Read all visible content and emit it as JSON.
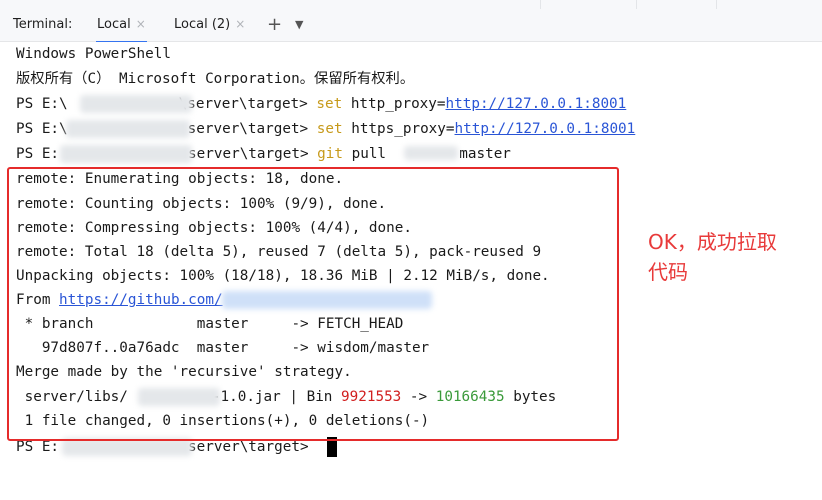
{
  "toolbar": {
    "label": "Terminal:",
    "tabs": [
      {
        "label": "Local",
        "close": "×"
      },
      {
        "label": "Local (2)",
        "close": "×"
      }
    ],
    "add": "+",
    "more": "⌄"
  },
  "terminal": {
    "l1": "Windows PowerShell",
    "l2": "版权所有（C） Microsoft Corporation。保留所有权利。",
    "l3": {
      "pre": "PS E:\\",
      "path": "\\server\\target> ",
      "cmd": "set",
      "rest": " http_proxy=",
      "url": "http://127.0.0.1:8001"
    },
    "l4": {
      "pre": "PS E:\\",
      "path": "server\\target> ",
      "cmd": "set",
      "rest": " https_proxy=",
      "url": "http://127.0.0.1:8001"
    },
    "l5": {
      "pre": "PS E:",
      "path": "server\\target> ",
      "cmd": "git",
      "rest": " pull ",
      "rest2": " master"
    },
    "l6": "remote: Enumerating objects: 18, done.",
    "l7": "remote: Counting objects: 100% (9/9), done.",
    "l8": "remote: Compressing objects: 100% (4/4), done.",
    "l9": "remote: Total 18 (delta 5), reused 7 (delta 5), pack-reused 9",
    "l10": "Unpacking objects: 100% (18/18), 18.36 MiB | 2.12 MiB/s, done.",
    "l11": {
      "pre": "From ",
      "url": "https://github.com/"
    },
    "l12": " * branch            master     -> FETCH_HEAD",
    "l13": "   97d807f..0a76adc  master     -> wisdom/master",
    "l14": "Merge made by the 'recursive' strategy.",
    "l15": {
      "pre": " server/libs/",
      "mid": "-1.0.jar | Bin ",
      "old": "9921553",
      "arrow": " -> ",
      "new": "10166435",
      "tail": " bytes"
    },
    "l16": " 1 file changed, 0 insertions(+), 0 deletions(-)",
    "l17": {
      "pre": "PS E:",
      "path": "server\\target> "
    }
  },
  "annotation": {
    "line1": "OK，成功拉取",
    "line2": "代码"
  },
  "colors": {
    "highlight_box": "#e52b2b",
    "annotation": "#e83a3a",
    "command": "#c79a1b",
    "url": "#2a55d6"
  }
}
